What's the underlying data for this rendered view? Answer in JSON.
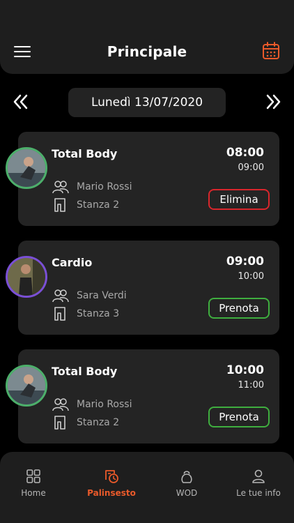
{
  "header": {
    "title": "Principale"
  },
  "date_nav": {
    "label": "Lunedì 13/07/2020"
  },
  "colors": {
    "accent": "#ea5a2a",
    "delete": "#d9262c",
    "book": "#3fae3f",
    "avatar_green": "#4caf6a",
    "avatar_purple": "#7a4fd6"
  },
  "classes": [
    {
      "name": "Total Body",
      "start": "08:00",
      "end": "09:00",
      "trainer": "Mario Rossi",
      "room": "Stanza 2",
      "action": "Elimina"
    },
    {
      "name": "Cardio",
      "start": "09:00",
      "end": "10:00",
      "trainer": "Sara Verdi",
      "room": "Stanza 3",
      "action": "Prenota"
    },
    {
      "name": "Total Body",
      "start": "10:00",
      "end": "11:00",
      "trainer": "Mario Rossi",
      "room": "Stanza 2",
      "action": "Prenota"
    }
  ],
  "bottom_nav": [
    {
      "label": "Home",
      "icon": "grid-icon"
    },
    {
      "label": "Palinsesto",
      "icon": "schedule-icon",
      "active": true
    },
    {
      "label": "WOD",
      "icon": "kettlebell-icon"
    },
    {
      "label": "Le tue info",
      "icon": "user-icon"
    }
  ]
}
